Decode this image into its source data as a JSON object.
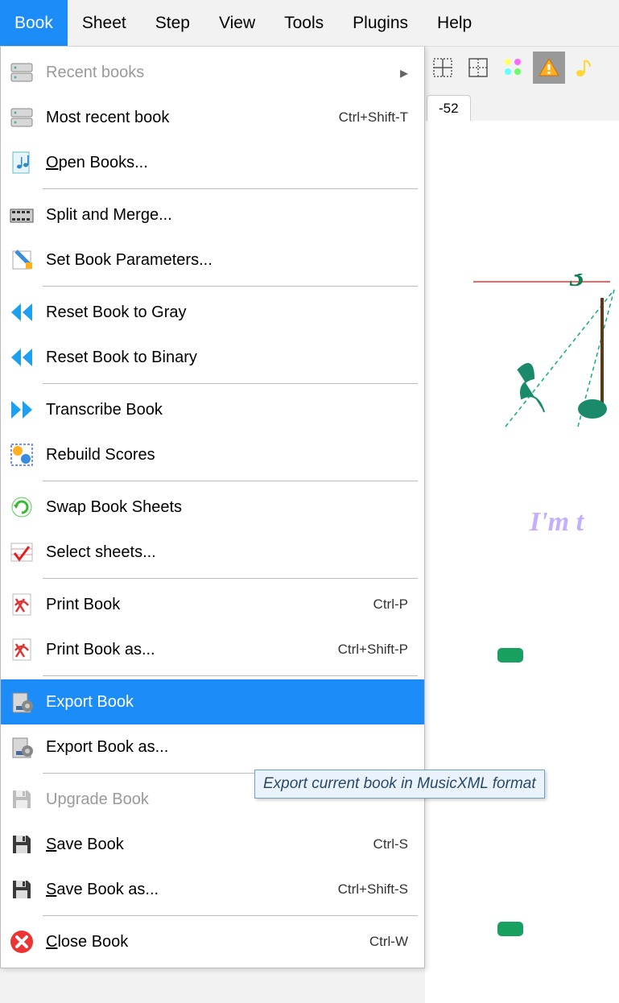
{
  "menubar": {
    "items": [
      {
        "label": "Book",
        "active": true
      },
      {
        "label": "Sheet",
        "active": false
      },
      {
        "label": "Step",
        "active": false
      },
      {
        "label": "View",
        "active": false
      },
      {
        "label": "Tools",
        "active": false
      },
      {
        "label": "Plugins",
        "active": false
      },
      {
        "label": "Help",
        "active": false
      }
    ]
  },
  "tab": {
    "label_partial": "-52"
  },
  "dropdown": {
    "items": [
      {
        "type": "item",
        "icon": "drive",
        "label": "Recent books",
        "disabled": true,
        "submenu": true
      },
      {
        "type": "item",
        "icon": "drive",
        "label": "Most recent book",
        "shortcut": "Ctrl+Shift-T"
      },
      {
        "type": "item",
        "icon": "book-music",
        "label": "Open Books...",
        "mnemonic_pos": 0
      },
      {
        "type": "sep"
      },
      {
        "type": "item",
        "icon": "film",
        "label": "Split and Merge..."
      },
      {
        "type": "item",
        "icon": "params",
        "label": "Set Book Parameters..."
      },
      {
        "type": "sep"
      },
      {
        "type": "item",
        "icon": "rewind",
        "label": "Reset Book to Gray"
      },
      {
        "type": "item",
        "icon": "rewind",
        "label": "Reset Book to Binary"
      },
      {
        "type": "sep"
      },
      {
        "type": "item",
        "icon": "forward",
        "label": "Transcribe Book"
      },
      {
        "type": "item",
        "icon": "rebuild",
        "label": "Rebuild Scores"
      },
      {
        "type": "sep"
      },
      {
        "type": "item",
        "icon": "swap",
        "label": "Swap Book Sheets"
      },
      {
        "type": "item",
        "icon": "select",
        "label": "Select sheets..."
      },
      {
        "type": "sep"
      },
      {
        "type": "item",
        "icon": "pdf",
        "label": "Print Book",
        "shortcut": "Ctrl-P"
      },
      {
        "type": "item",
        "icon": "pdf",
        "label": "Print Book as...",
        "shortcut": "Ctrl+Shift-P"
      },
      {
        "type": "sep"
      },
      {
        "type": "item",
        "icon": "export",
        "label": "Export Book",
        "highlighted": true
      },
      {
        "type": "item",
        "icon": "export",
        "label": "Export Book as..."
      },
      {
        "type": "sep"
      },
      {
        "type": "item",
        "icon": "save-grey",
        "label": "Upgrade Book",
        "disabled": true
      },
      {
        "type": "item",
        "icon": "save",
        "label": "Save Book",
        "mnemonic_pos": 0,
        "shortcut": "Ctrl-S"
      },
      {
        "type": "item",
        "icon": "save",
        "label": "Save Book as...",
        "mnemonic_pos": 0,
        "shortcut": "Ctrl+Shift-S"
      },
      {
        "type": "sep"
      },
      {
        "type": "item",
        "icon": "close",
        "label": "Close Book",
        "mnemonic_pos": 0,
        "shortcut": "Ctrl-W"
      }
    ]
  },
  "tooltip": {
    "text": "Export current book in MusicXML format"
  },
  "canvas": {
    "triplet": "3",
    "lyric_partial": "I'm t"
  }
}
